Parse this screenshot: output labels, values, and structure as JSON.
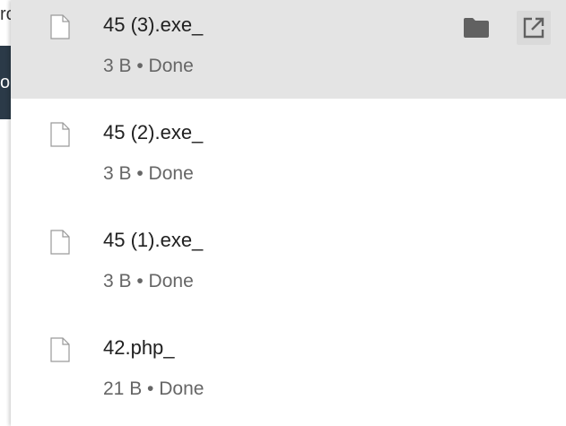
{
  "background": {
    "partial_text_top": "ro",
    "partial_text_dark": "ol"
  },
  "downloads": [
    {
      "name": "45 (3).exe_",
      "status": "3 B • Done",
      "icon": "file-icon",
      "highlighted": true
    },
    {
      "name": "45 (2).exe_",
      "status": "3 B • Done",
      "icon": "file-icon",
      "highlighted": false
    },
    {
      "name": "45 (1).exe_",
      "status": "3 B • Done",
      "icon": "file-icon",
      "highlighted": false
    },
    {
      "name": "42.php_",
      "status": "21 B • Done",
      "icon": "file-icon",
      "highlighted": false
    }
  ],
  "actions": {
    "show_in_folder_icon": "folder-icon",
    "open_icon": "open-external-icon"
  },
  "colors": {
    "highlight": "#e4e4e4",
    "icon_gray": "#616161",
    "dark_block": "#2b3a48"
  }
}
